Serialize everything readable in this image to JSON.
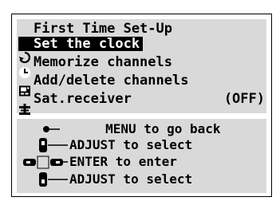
{
  "menu": {
    "title": "First Time Set-Up",
    "title_icon": "return-icon",
    "items": [
      {
        "label": "Set the clock",
        "icon": "clock-icon",
        "selected": true
      },
      {
        "label": "Memorize channels",
        "icon": "tv-icon",
        "selected": false
      },
      {
        "label": "Add/delete channels",
        "icon": "channel-edit-icon",
        "selected": false
      },
      {
        "label": "Sat.receiver",
        "icon": "satellite-dish-icon",
        "selected": false,
        "value": "(OFF)"
      }
    ]
  },
  "help": {
    "back": "MENU to go back",
    "adjust_up": "ADJUST to select",
    "enter": "ENTER to enter",
    "adjust_down": "ADJUST to select"
  },
  "colors": {
    "panel": "#d9d9d9",
    "selected_bg": "#000000",
    "selected_fg": "#ffffff"
  }
}
